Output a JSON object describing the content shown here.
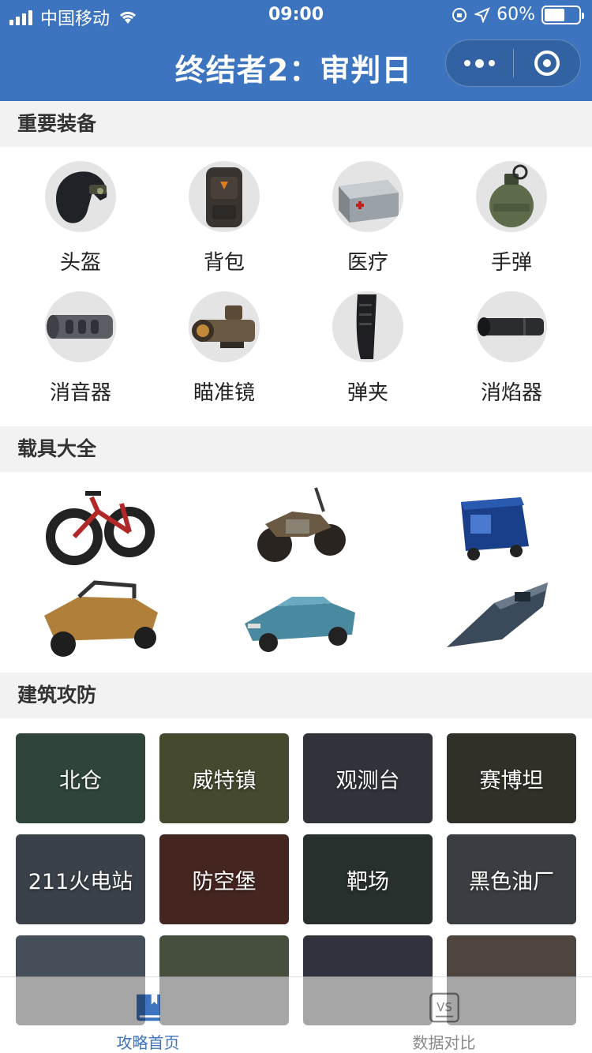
{
  "status_bar": {
    "carrier": "中国移动",
    "time": "09:00",
    "battery": "60%"
  },
  "header": {
    "title": "终结者2：审判日"
  },
  "sections": {
    "equipment": "重要装备",
    "vehicles": "载具大全",
    "buildings": "建筑攻防"
  },
  "equipment": [
    {
      "label": "头盔",
      "icon": "helmet-icon"
    },
    {
      "label": "背包",
      "icon": "backpack-icon"
    },
    {
      "label": "医疗",
      "icon": "medkit-icon"
    },
    {
      "label": "手弹",
      "icon": "grenade-icon"
    },
    {
      "label": "消音器",
      "icon": "suppressor-icon"
    },
    {
      "label": "瞄准镜",
      "icon": "scope-icon"
    },
    {
      "label": "弹夹",
      "icon": "magazine-icon"
    },
    {
      "label": "消焰器",
      "icon": "flash-hider-icon"
    }
  ],
  "vehicles": [
    {
      "icon": "bicycle-icon"
    },
    {
      "icon": "motorcycle-icon"
    },
    {
      "icon": "tuk-tuk-icon"
    },
    {
      "icon": "buggy-icon"
    },
    {
      "icon": "convertible-car-icon"
    },
    {
      "icon": "speedboat-icon"
    }
  ],
  "buildings": [
    {
      "label": "北仓",
      "color": "#4a6a5a"
    },
    {
      "label": "威特镇",
      "color": "#6b7048"
    },
    {
      "label": "观测台",
      "color": "#4a4f5a"
    },
    {
      "label": "赛博坦",
      "color": "#4b4a3e"
    },
    {
      "label": "211火电站",
      "color": "#5a6470"
    },
    {
      "label": "防空堡",
      "color": "#6a3a32"
    },
    {
      "label": "靶场",
      "color": "#3e4a48"
    },
    {
      "label": "黑色油厂",
      "color": "#5a5f66"
    },
    {
      "label": "",
      "color": "#6a7a8a"
    },
    {
      "label": "",
      "color": "#6c7a60"
    },
    {
      "label": "",
      "color": "#4a4f5f"
    },
    {
      "label": "",
      "color": "#7a6a62"
    }
  ],
  "tabs": [
    {
      "label": "攻略首页",
      "active": true
    },
    {
      "label": "数据对比",
      "active": false
    }
  ],
  "colors": {
    "brand": "#3d74bf",
    "section_bg": "#f2f2f2",
    "inactive_tab": "#8a8a8a"
  }
}
